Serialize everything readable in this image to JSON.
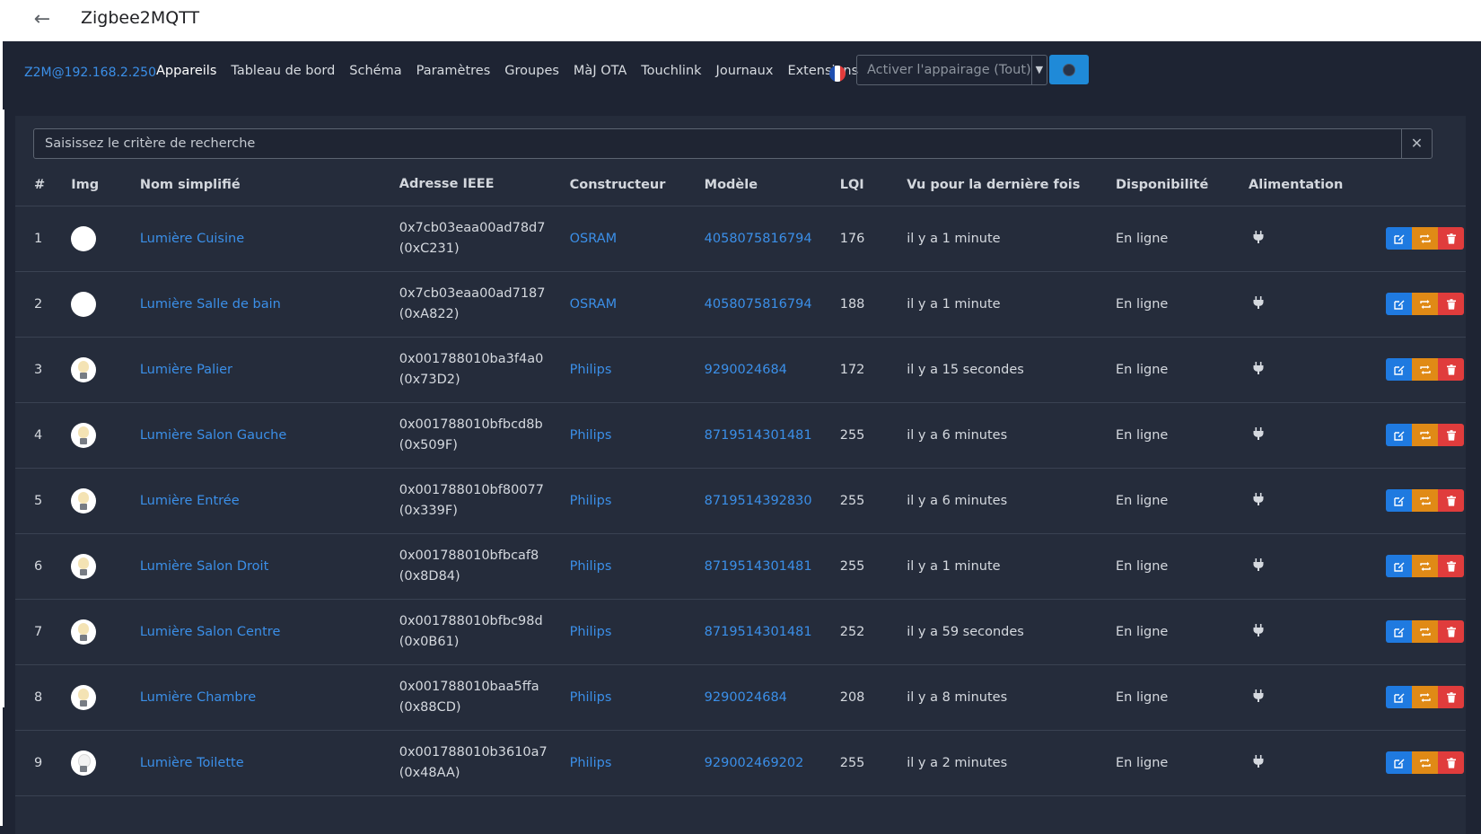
{
  "appbar": {
    "title": "Zigbee2MQTT",
    "back_icon": "arrow-left-icon"
  },
  "navbar": {
    "brand": "Z2M@192.168.2.250",
    "links": [
      "Appareils",
      "Tableau de bord",
      "Schéma",
      "Paramètres",
      "Groupes",
      "MàJ OTA",
      "Touchlink",
      "Journaux",
      "Extensions"
    ],
    "active_link": "Appareils",
    "language_icon": "french-flag-icon",
    "permit_join_label": "Activer l'appairage (Tout)",
    "permit_join_icon": "permit-join-icon"
  },
  "search": {
    "placeholder": "Saisissez le critère de recherche",
    "clear_icon": "close-icon"
  },
  "table": {
    "headers": [
      "#",
      "Img",
      "Nom simplifié",
      "Adresse IEEE",
      "Constructeur",
      "Modèle",
      "LQI",
      "Vu pour la dernière fois",
      "Disponibilité",
      "Alimentation"
    ],
    "rows": [
      {
        "idx": "1",
        "name": "Lumière Cuisine",
        "ieee": "0x7cb03eaa00ad78d7",
        "nwk": "(0xC231)",
        "manufacturer": "OSRAM",
        "model": "4058075816794",
        "lqi": "176",
        "last_seen": "il y a 1 minute",
        "availability": "En ligne",
        "img": "round-bulb"
      },
      {
        "idx": "2",
        "name": "Lumière Salle de bain",
        "ieee": "0x7cb03eaa00ad7187",
        "nwk": "(0xA822)",
        "manufacturer": "OSRAM",
        "model": "4058075816794",
        "lqi": "188",
        "last_seen": "il y a 1 minute",
        "availability": "En ligne",
        "img": "round-bulb"
      },
      {
        "idx": "3",
        "name": "Lumière Palier",
        "ieee": "0x001788010ba3f4a0",
        "nwk": "(0x73D2)",
        "manufacturer": "Philips",
        "model": "9290024684",
        "lqi": "172",
        "last_seen": "il y a 15 secondes",
        "availability": "En ligne",
        "img": "bulb"
      },
      {
        "idx": "4",
        "name": "Lumière Salon Gauche",
        "ieee": "0x001788010bfbcd8b",
        "nwk": "(0x509F)",
        "manufacturer": "Philips",
        "model": "8719514301481",
        "lqi": "255",
        "last_seen": "il y a 6 minutes",
        "availability": "En ligne",
        "img": "bulb"
      },
      {
        "idx": "5",
        "name": "Lumière Entrée",
        "ieee": "0x001788010bf80077",
        "nwk": "(0x339F)",
        "manufacturer": "Philips",
        "model": "8719514392830",
        "lqi": "255",
        "last_seen": "il y a 6 minutes",
        "availability": "En ligne",
        "img": "bulb"
      },
      {
        "idx": "6",
        "name": "Lumière Salon Droit",
        "ieee": "0x001788010bfbcaf8",
        "nwk": "(0x8D84)",
        "manufacturer": "Philips",
        "model": "8719514301481",
        "lqi": "255",
        "last_seen": "il y a 1 minute",
        "availability": "En ligne",
        "img": "bulb"
      },
      {
        "idx": "7",
        "name": "Lumière Salon Centre",
        "ieee": "0x001788010bfbc98d",
        "nwk": "(0x0B61)",
        "manufacturer": "Philips",
        "model": "8719514301481",
        "lqi": "252",
        "last_seen": "il y a 59 secondes",
        "availability": "En ligne",
        "img": "bulb"
      },
      {
        "idx": "8",
        "name": "Lumière Chambre",
        "ieee": "0x001788010baa5ffa",
        "nwk": "(0x88CD)",
        "manufacturer": "Philips",
        "model": "9290024684",
        "lqi": "208",
        "last_seen": "il y a 8 minutes",
        "availability": "En ligne",
        "img": "bulb"
      },
      {
        "idx": "9",
        "name": "Lumière Toilette",
        "ieee": "0x001788010b3610a7",
        "nwk": "(0x48AA)",
        "manufacturer": "Philips",
        "model": "929002469202",
        "lqi": "255",
        "last_seen": "il y a 2 minutes",
        "availability": "En ligne",
        "img": "bulb-white"
      }
    ],
    "power_icon": "plug-icon",
    "action_icons": [
      "edit-icon",
      "reconfigure-icon",
      "delete-icon"
    ]
  },
  "colors": {
    "link": "#3b8fe8",
    "background": "#1e2433",
    "card": "#252c3b",
    "edit": "#1f7ae0",
    "reconfigure": "#e08a16",
    "delete": "#e03c3c",
    "permit": "#1f8ad8"
  }
}
